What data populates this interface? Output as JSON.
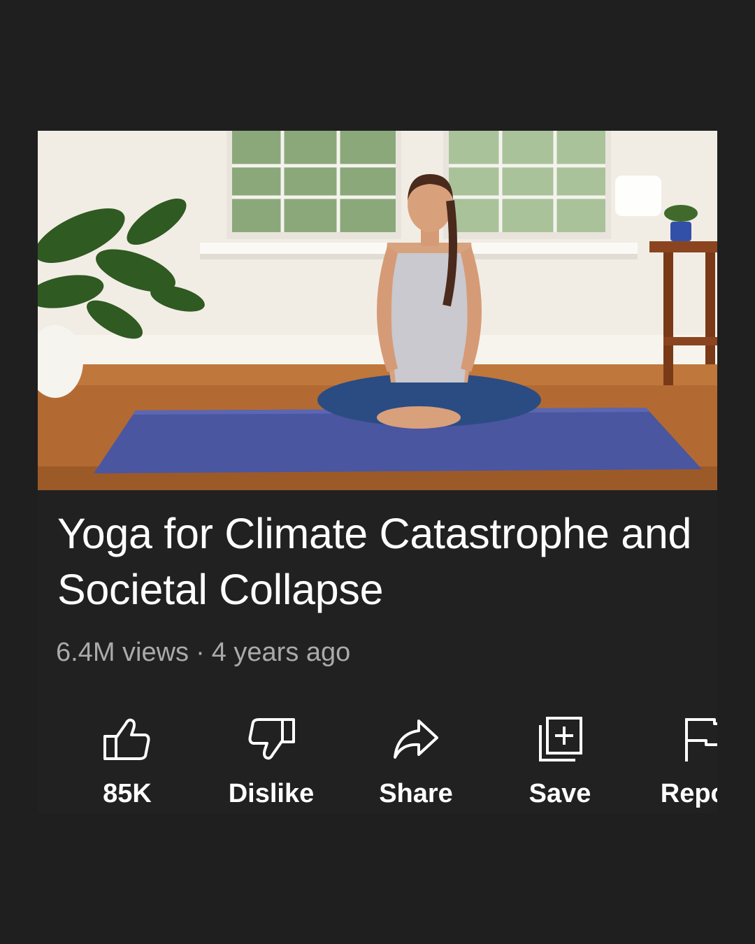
{
  "video": {
    "title": "Yoga for Climate Catastrophe and Societal Collapse",
    "views": "6.4M views",
    "separator": "·",
    "age": "4 years ago"
  },
  "actions": [
    {
      "label": "85K",
      "icon": "thumbs-up-icon"
    },
    {
      "label": "Dislike",
      "icon": "thumbs-down-icon"
    },
    {
      "label": "Share",
      "icon": "share-arrow-icon"
    },
    {
      "label": "Save",
      "icon": "add-to-playlist-icon"
    },
    {
      "label": "Report",
      "icon": "flag-icon"
    }
  ]
}
